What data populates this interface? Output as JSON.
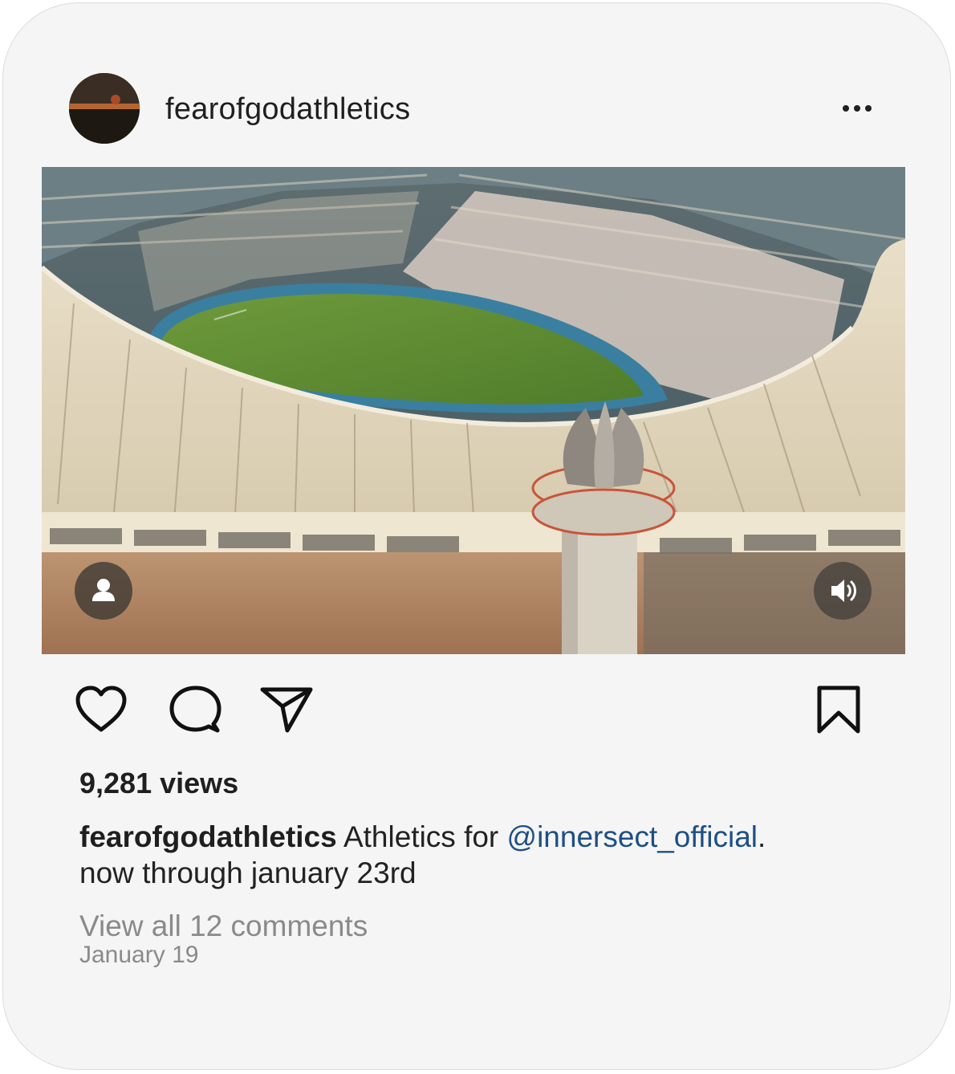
{
  "post": {
    "username": "fearofgodathletics",
    "more_icon": "more-horizontal-icon",
    "media": {
      "type": "video",
      "tag_icon": "person-icon",
      "sound_icon": "speaker-volume-icon"
    },
    "actions": {
      "like_icon": "heart-icon",
      "comment_icon": "comment-bubble-icon",
      "share_icon": "paper-plane-icon",
      "save_icon": "bookmark-icon"
    },
    "views": "9,281 views",
    "caption": {
      "username": "fearofgodathletics",
      "text_before": " Athletics for ",
      "mention": "@innersect_official",
      "text_after": ".",
      "line2": "now through january 23rd"
    },
    "view_comments": "View all 12 comments",
    "date": "January 19"
  },
  "colors": {
    "card_background": "#f5f5f5",
    "text": "#1f1f1f",
    "mention": "#1d4f86",
    "muted": "#8a8a8a"
  }
}
